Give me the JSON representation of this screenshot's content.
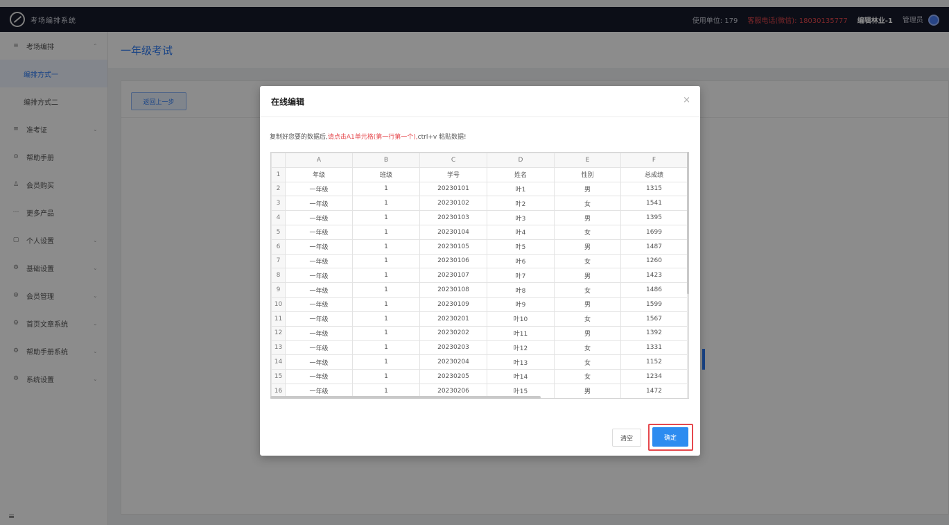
{
  "header": {
    "app_name": "考场编排系统",
    "units_label": "使用单位: 179",
    "hotline": "客服电话(微信): 18030135777",
    "account": "编辑林业-1",
    "role": "管理员"
  },
  "sidebar": {
    "items": [
      {
        "icon": "≡",
        "label": "考场编排",
        "chevron": "⌃"
      },
      {
        "icon": "",
        "label": "编排方式一",
        "chevron": ""
      },
      {
        "icon": "",
        "label": "编排方式二",
        "chevron": ""
      },
      {
        "icon": "≡",
        "label": "准考证",
        "chevron": "⌄"
      },
      {
        "icon": "⊙",
        "label": "帮助手册",
        "chevron": ""
      },
      {
        "icon": "♙",
        "label": "会员购买",
        "chevron": ""
      },
      {
        "icon": "⋯",
        "label": "更多产品",
        "chevron": ""
      },
      {
        "icon": "▢",
        "label": "个人设置",
        "chevron": "⌄"
      },
      {
        "icon": "⚙",
        "label": "基础设置",
        "chevron": "⌄"
      },
      {
        "icon": "⚙",
        "label": "会员管理",
        "chevron": "⌄"
      },
      {
        "icon": "⚙",
        "label": "首页文章系统",
        "chevron": "⌄"
      },
      {
        "icon": "⚙",
        "label": "帮助手册系统",
        "chevron": "⌄"
      },
      {
        "icon": "⚙",
        "label": "系统设置",
        "chevron": "⌄"
      }
    ],
    "toggle": "≡"
  },
  "page": {
    "title": "一年级考试",
    "back_label": "返回上一步"
  },
  "modal": {
    "title": "在线编辑",
    "close": "×",
    "instruction_prefix": "复制好您要的数据后,",
    "instruction_red": "请点击A1单元格(第一行第一个),",
    "instruction_suffix": "ctrl+v 粘贴数据!",
    "clear_label": "清空",
    "confirm_label": "确定"
  },
  "sheet": {
    "columns": [
      "A",
      "B",
      "C",
      "D",
      "E",
      "F"
    ],
    "rows": [
      [
        "1",
        "年级",
        "班级",
        "学号",
        "姓名",
        "性别",
        "总成绩"
      ],
      [
        "2",
        "一年级",
        "1",
        "20230101",
        "叶1",
        "男",
        "1315"
      ],
      [
        "3",
        "一年级",
        "1",
        "20230102",
        "叶2",
        "女",
        "1541"
      ],
      [
        "4",
        "一年级",
        "1",
        "20230103",
        "叶3",
        "男",
        "1395"
      ],
      [
        "5",
        "一年级",
        "1",
        "20230104",
        "叶4",
        "女",
        "1699"
      ],
      [
        "6",
        "一年级",
        "1",
        "20230105",
        "叶5",
        "男",
        "1487"
      ],
      [
        "7",
        "一年级",
        "1",
        "20230106",
        "叶6",
        "女",
        "1260"
      ],
      [
        "8",
        "一年级",
        "1",
        "20230107",
        "叶7",
        "男",
        "1423"
      ],
      [
        "9",
        "一年级",
        "1",
        "20230108",
        "叶8",
        "女",
        "1486"
      ],
      [
        "10",
        "一年级",
        "1",
        "20230109",
        "叶9",
        "男",
        "1599"
      ],
      [
        "11",
        "一年级",
        "1",
        "20230201",
        "叶10",
        "女",
        "1567"
      ],
      [
        "12",
        "一年级",
        "1",
        "20230202",
        "叶11",
        "男",
        "1392"
      ],
      [
        "13",
        "一年级",
        "1",
        "20230203",
        "叶12",
        "女",
        "1331"
      ],
      [
        "14",
        "一年级",
        "1",
        "20230204",
        "叶13",
        "女",
        "1152"
      ],
      [
        "15",
        "一年级",
        "1",
        "20230205",
        "叶14",
        "女",
        "1234"
      ],
      [
        "16",
        "一年级",
        "1",
        "20230206",
        "叶15",
        "男",
        "1472"
      ]
    ]
  },
  "colors": {
    "topbar": "#161a2a",
    "accent": "#2d7bf4",
    "highlight": "#e5484d"
  }
}
